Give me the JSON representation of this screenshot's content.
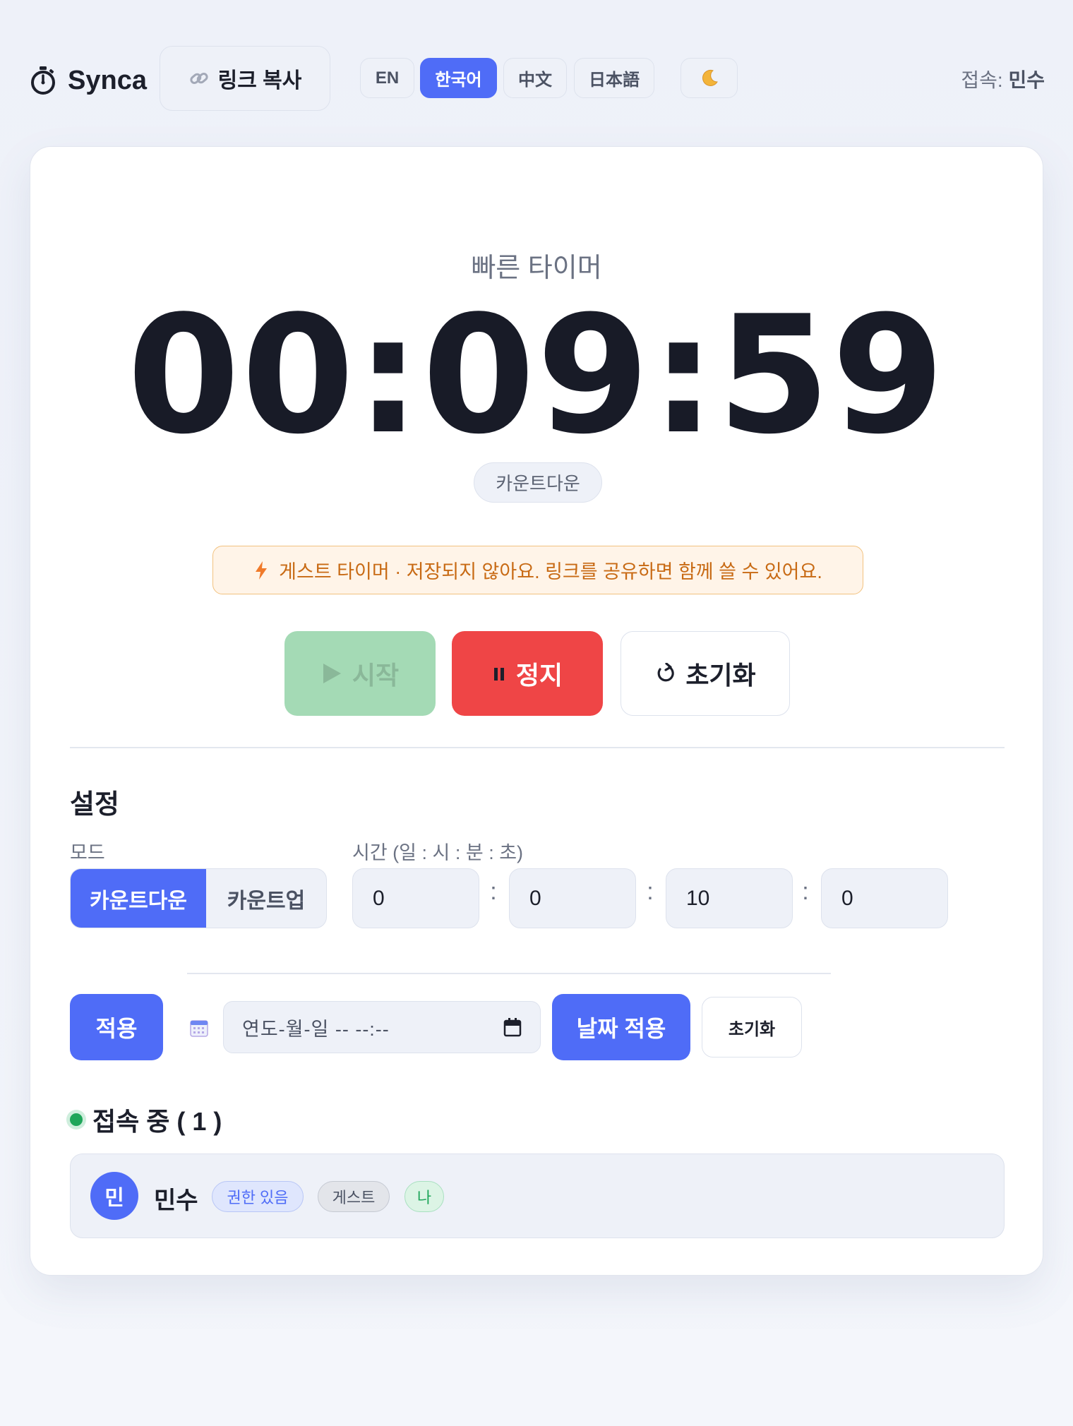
{
  "header": {
    "logo_text": "Synca",
    "copy_link_label": "링크 복사",
    "languages": [
      {
        "label": "EN",
        "active": false
      },
      {
        "label": "한국어",
        "active": true
      },
      {
        "label": "中文",
        "active": false
      },
      {
        "label": "日本語",
        "active": false
      }
    ],
    "theme_icon": "moon-icon",
    "connected_label": "접속:",
    "connected_user": "민수"
  },
  "timer": {
    "title": "빠른 타이머",
    "display": "00:09:59",
    "mode_badge": "카운트다운",
    "guest_note": "게스트 타이머 · 저장되지 않아요. 링크를 공유하면 함께 쓸 수 있어요.",
    "start_label": "시작",
    "stop_label": "정지",
    "reset_label": "초기화"
  },
  "settings": {
    "title": "설정",
    "mode_label": "모드",
    "mode_options": [
      {
        "label": "카운트다운",
        "active": true
      },
      {
        "label": "카운트업",
        "active": false
      }
    ],
    "time_label": "시간 (일 : 시 : 분 : 초)",
    "time_values": [
      "0",
      "0",
      "10",
      "0"
    ],
    "time_separator": ":",
    "apply_label": "적용",
    "date_placeholder": "연도-월-일 -- --:--",
    "date_apply_label": "날짜 적용",
    "date_reset_label": "초기화"
  },
  "online": {
    "title": "접속 중 ( 1 )",
    "users": [
      {
        "initial": "민",
        "name": "민수",
        "tags": [
          "권한 있음",
          "게스트",
          "나"
        ]
      }
    ]
  },
  "colors": {
    "accent": "#4f6cf7",
    "danger": "#ef4546",
    "success_disabled": "#a4dab5",
    "online": "#1fa65a",
    "warning_text": "#c86a14"
  }
}
